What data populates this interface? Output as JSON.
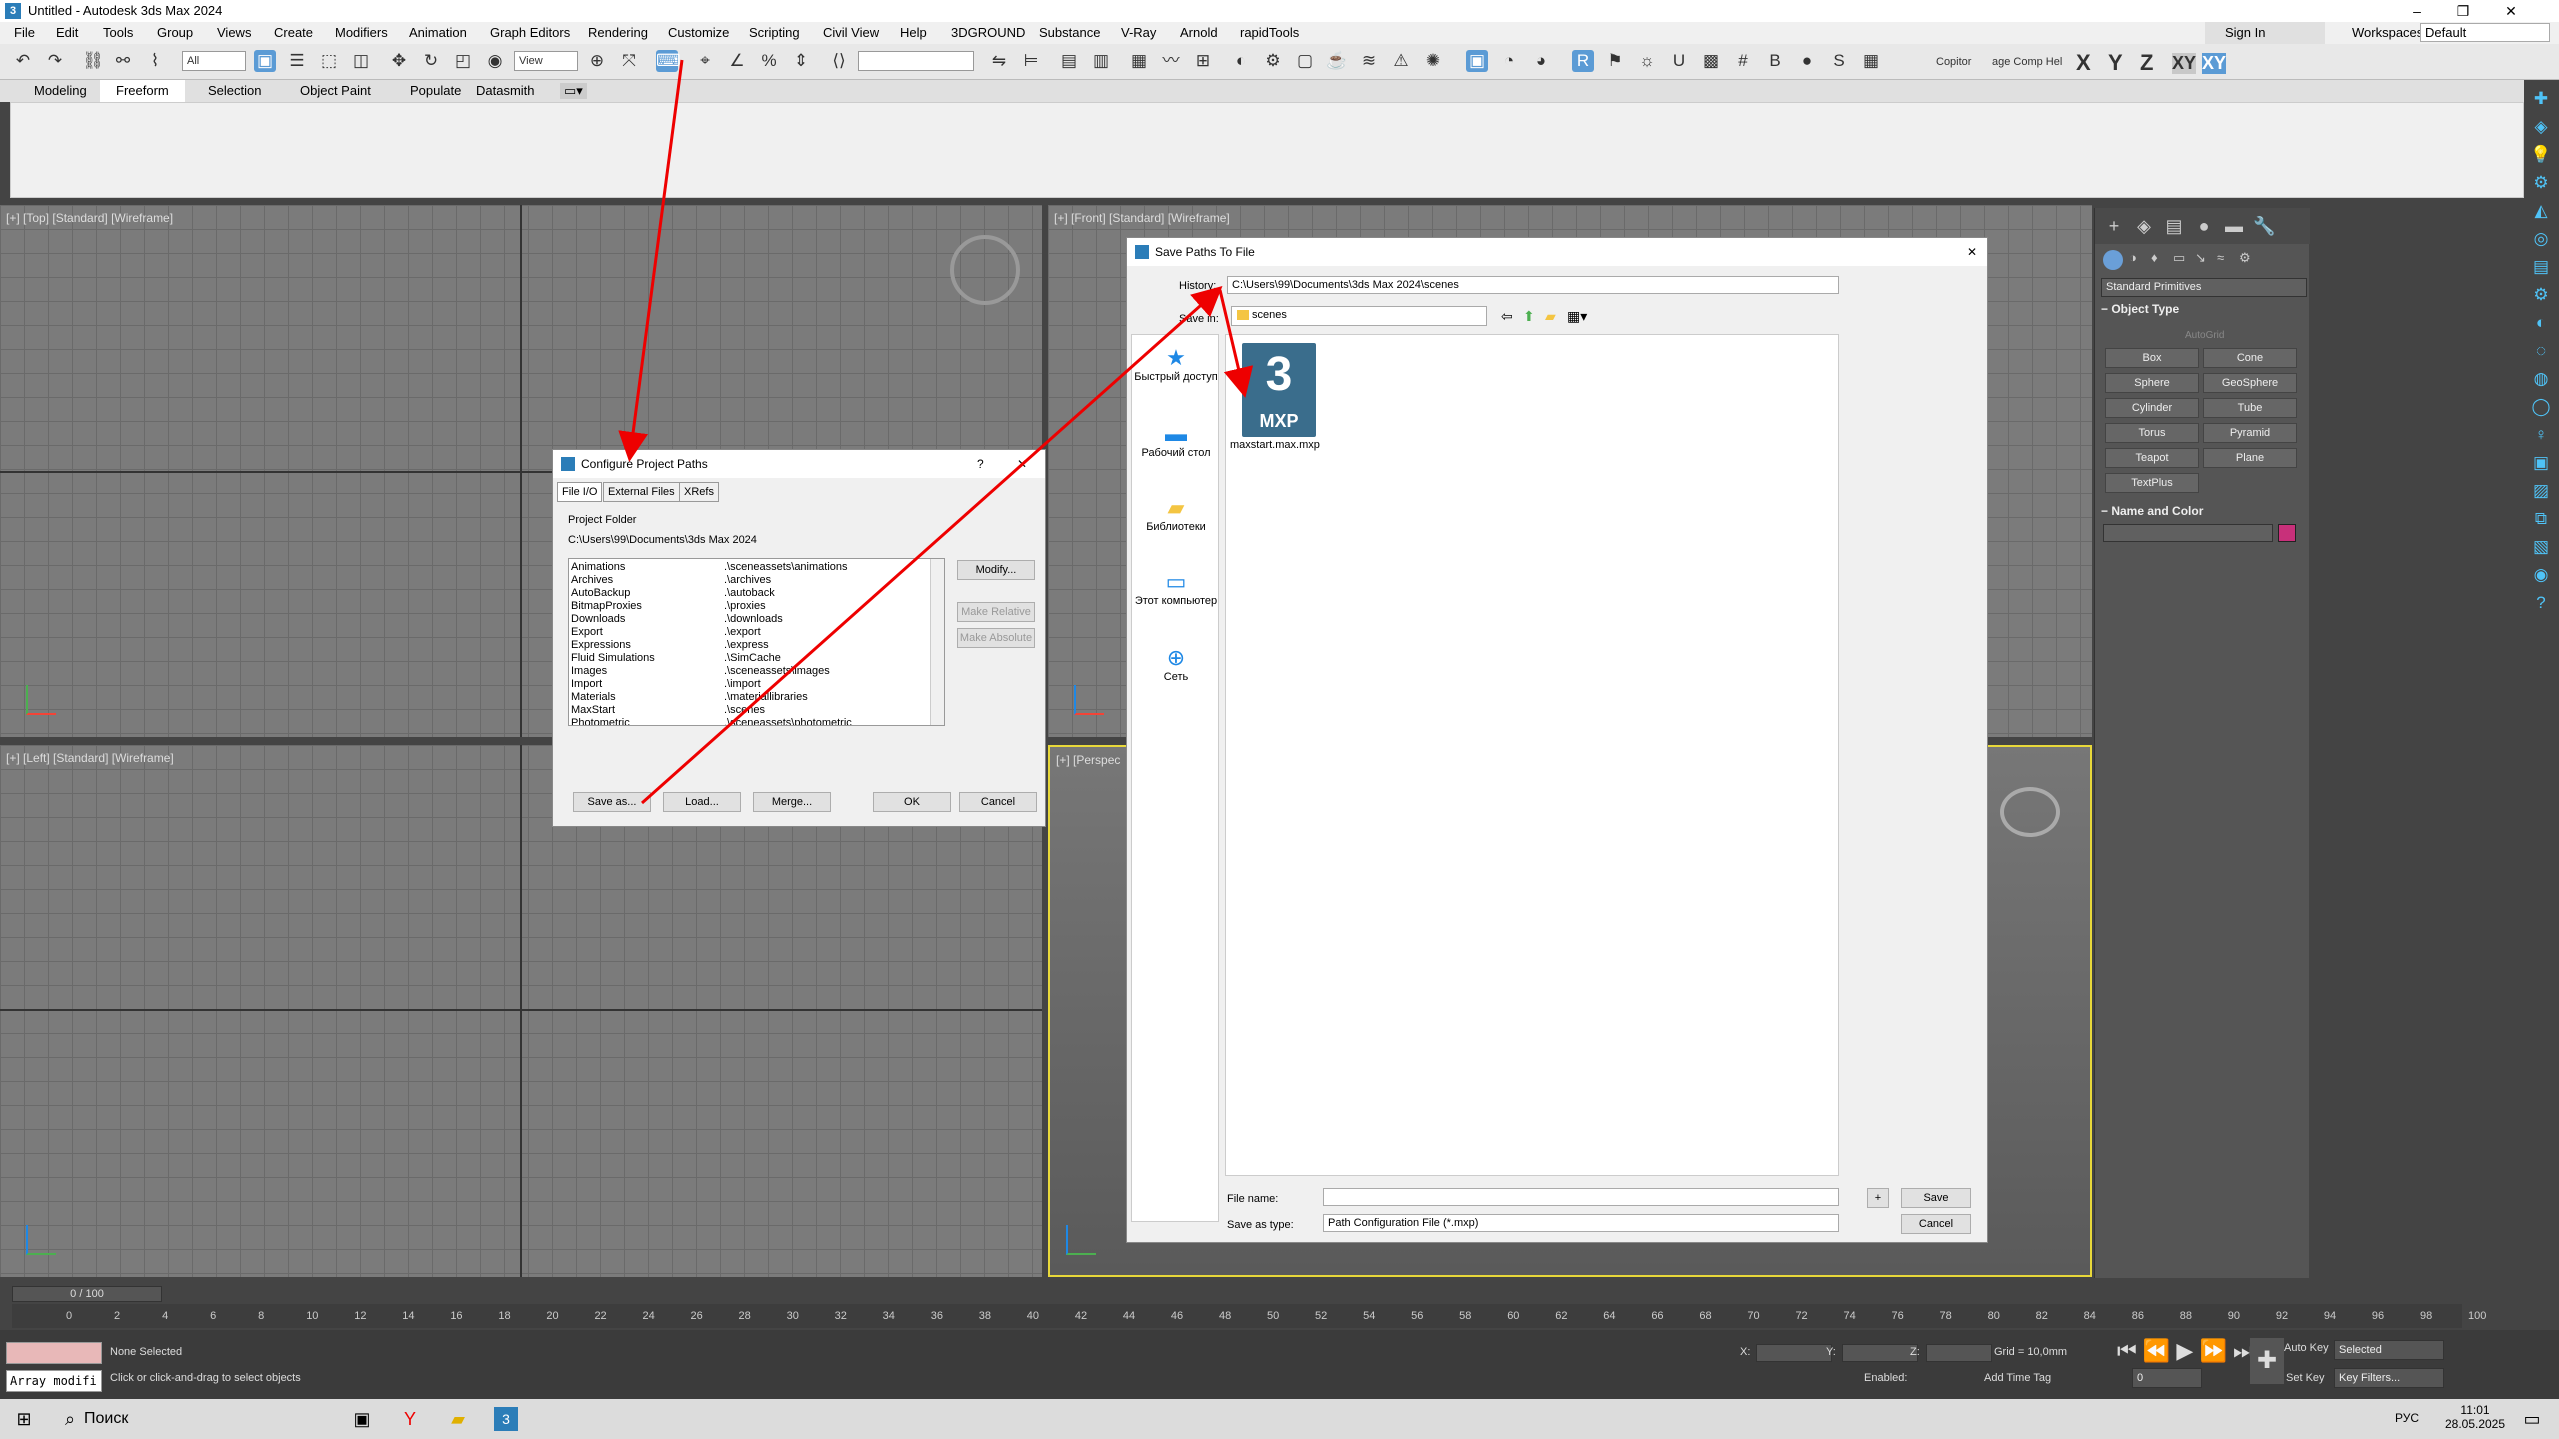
{
  "window": {
    "title": "Untitled - Autodesk 3ds Max 2024"
  },
  "menu": {
    "items": [
      "File",
      "Edit",
      "Tools",
      "Group",
      "Views",
      "Create",
      "Modifiers",
      "Animation",
      "Graph Editors",
      "Rendering",
      "Customize",
      "Scripting",
      "Civil View",
      "Help",
      "3DGROUND",
      "Substance",
      "V-Ray",
      "Arnold",
      "rapidTools"
    ],
    "sign_in": "Sign In",
    "workspaces_label": "Workspaces:",
    "workspace_value": "Default"
  },
  "toolbar": {
    "selection_filter": "All",
    "ref_coord": "View",
    "copitor": "Copitor",
    "comp_help": "age Comp Hel",
    "axes": [
      "X",
      "Y",
      "Z",
      "XY",
      "XY"
    ]
  },
  "ribbon": {
    "tabs": [
      "Modeling",
      "Freeform",
      "Selection",
      "Object Paint",
      "Populate",
      "Datasmith"
    ],
    "active": "Freeform"
  },
  "viewports": {
    "top": "[+] [Top] [Standard] [Wireframe]",
    "front": "[+] [Front] [Standard] [Wireframe]",
    "left": "[+] [Left] [Standard] [Wireframe]",
    "perspective": "[+] [Perspec"
  },
  "command_panel": {
    "dropdown": "Standard Primitives",
    "object_type": "Object Type",
    "autogrid": "AutoGrid",
    "buttons": [
      "Box",
      "Cone",
      "Sphere",
      "GeoSphere",
      "Cylinder",
      "Tube",
      "Torus",
      "Pyramid",
      "Teapot",
      "Plane",
      "TextPlus"
    ],
    "name_and_color": "Name and Color",
    "swatch_color": "#c8307a"
  },
  "configure_dialog": {
    "title": "Configure Project Paths",
    "help": "?",
    "tabs": [
      "File I/O",
      "External Files",
      "XRefs"
    ],
    "project_folder_label": "Project Folder",
    "project_folder_path": "C:\\Users\\99\\Documents\\3ds Max 2024",
    "paths": [
      {
        "name": "Animations",
        "path": ".\\sceneassets\\animations"
      },
      {
        "name": "Archives",
        "path": ".\\archives"
      },
      {
        "name": "AutoBackup",
        "path": ".\\autoback"
      },
      {
        "name": "BitmapProxies",
        "path": ".\\proxies"
      },
      {
        "name": "Downloads",
        "path": ".\\downloads"
      },
      {
        "name": "Export",
        "path": ".\\export"
      },
      {
        "name": "Expressions",
        "path": ".\\express"
      },
      {
        "name": "Fluid Simulations",
        "path": ".\\SimCache"
      },
      {
        "name": "Images",
        "path": ".\\sceneassets\\images"
      },
      {
        "name": "Import",
        "path": ".\\import"
      },
      {
        "name": "Materials",
        "path": ".\\materiallibraries"
      },
      {
        "name": "MaxStart",
        "path": ".\\scenes"
      },
      {
        "name": "Photometric",
        "path": ".\\sceneassets\\photometric"
      }
    ],
    "modify": "Modify...",
    "make_relative": "Make Relative",
    "make_absolute": "Make Absolute",
    "save_as": "Save as...",
    "load": "Load...",
    "merge": "Merge...",
    "ok": "OK",
    "cancel": "Cancel"
  },
  "save_dialog": {
    "title": "Save Paths To File",
    "history_label": "History:",
    "history_value": "C:\\Users\\99\\Documents\\3ds Max 2024\\scenes",
    "save_in_label": "Save in:",
    "save_in_value": "scenes",
    "places": [
      "Быстрый доступ",
      "Рабочий стол",
      "Библиотеки",
      "Этот компьютер",
      "Сеть"
    ],
    "file_icon_number": "3",
    "file_icon_ext": "MXP",
    "file_name_item": "maxstart.max.mxp",
    "file_name_label": "File name:",
    "file_name_value": "",
    "save_type_label": "Save as type:",
    "save_type_value": "Path Configuration File (*.mxp)",
    "plus": "+",
    "save": "Save",
    "cancel": "Cancel"
  },
  "timeline": {
    "frame": "0 / 100",
    "ticks": [
      "0",
      "2",
      "4",
      "6",
      "8",
      "10",
      "12",
      "14",
      "16",
      "18",
      "20",
      "22",
      "24",
      "26",
      "28",
      "30",
      "32",
      "34",
      "36",
      "38",
      "40",
      "42",
      "44",
      "46",
      "48",
      "50",
      "52",
      "54",
      "56",
      "58",
      "60",
      "62",
      "64",
      "66",
      "68",
      "70",
      "72",
      "74",
      "76",
      "78",
      "80",
      "82",
      "84",
      "86",
      "88",
      "90",
      "92",
      "94",
      "96",
      "98",
      "100"
    ]
  },
  "status": {
    "selection": "None Selected",
    "prompt": "Click or click-and-drag to select objects",
    "maxscript": "Array modifi",
    "x_label": "X:",
    "y_label": "Y:",
    "z_label": "Z:",
    "grid": "Grid = 10,0mm",
    "enabled": "Enabled:",
    "time_tag": "Add Time Tag",
    "auto_key": "Auto Key",
    "set_key": "Set Key",
    "selected": "Selected",
    "frame_value": "0",
    "key_filters": "Key Filters..."
  },
  "taskbar": {
    "search": "Поиск",
    "lang": "РУС",
    "time": "11:01",
    "date": "28.05.2025"
  }
}
